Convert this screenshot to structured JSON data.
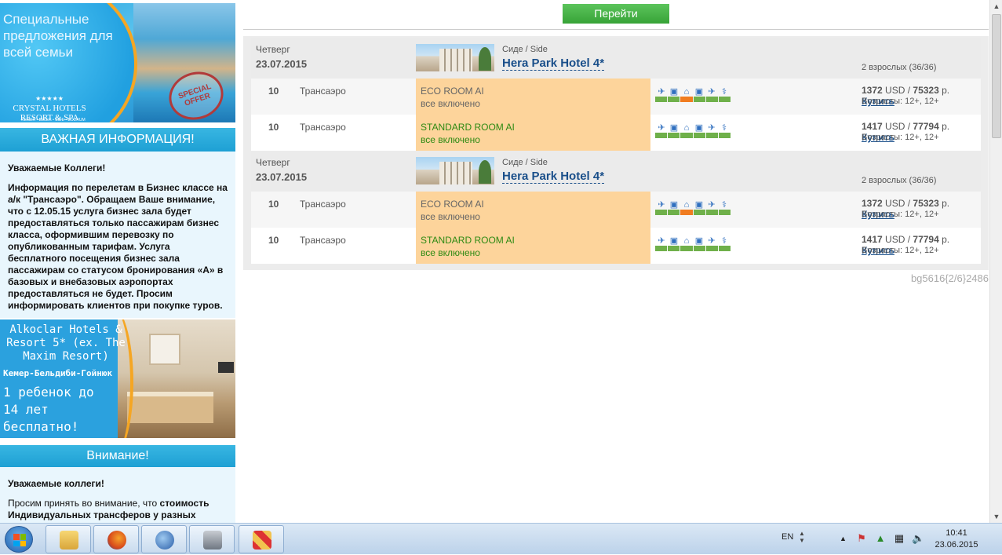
{
  "sidebar": {
    "banner1": {
      "headline": "Специальные предложения для всей семьи",
      "brand": "CRYSTAL HOTELS",
      "brand_sub": "RESORT & SPA",
      "locations": "KEMER • BELEK • SIDE • BODRUM"
    },
    "important": {
      "title": "ВАЖНАЯ ИНФОРМАЦИЯ!",
      "greeting": "Уважаемые Коллеги!",
      "text": "Информация по перелетам в Бизнес классе на а/к \"Трансаэро\". Обращаем Ваше внимание, что с 12.05.15 услуга бизнес зала будет предоставляться только пассажирам бизнес класса, оформившим перевозку по опубликованным тарифам. Услуга бесплатного посещения бизнес зала пассажирам со статусом бронирования «А» в базовых и внебазовых аэропортах предоставляться не будет. Просим информировать клиентов при покупке туров."
    },
    "banner2": {
      "hotel": "Alkoclar Hotels & Resort 5* (ex. The Maxim Resort)",
      "location": "Кемер-Бельдиби-Гойнюк",
      "offer": "1 ребенок до 14 лет бесплатно!"
    },
    "attention": {
      "title": "Внимание!",
      "greeting": "Уважаемые коллеги!",
      "text_plain": "Просим принять во внимание, что",
      "text_bold": "стоимость Индивидуальных трансферов у разных"
    }
  },
  "main": {
    "go_button": "Перейти",
    "hotels": [
      {
        "day": "Четверг",
        "date": "23.07.2015",
        "location": "Сиде / Side",
        "name": "Hera Park Hotel 4*",
        "pax": "2 взрослых (36/36)",
        "rows": [
          {
            "nights": "10",
            "airline": "Трансаэро",
            "room": "ECO ROOM AI",
            "meal": "все включено",
            "room_color": "gray",
            "price_usd": "1372",
            "price_rub": "75323",
            "currency": "USD",
            "rub_suffix": "р.",
            "buy": "Купить",
            "ages": "Возрасты: 12+, 12+",
            "bars": [
              "g",
              "g",
              "o",
              "g",
              "g",
              "g"
            ]
          },
          {
            "nights": "10",
            "airline": "Трансаэро",
            "room": "STANDARD ROOM AI",
            "meal": "все включено",
            "room_color": "green",
            "price_usd": "1417",
            "price_rub": "77794",
            "currency": "USD",
            "rub_suffix": "р.",
            "buy": "Купить",
            "ages": "Возрасты: 12+, 12+",
            "bars": [
              "g",
              "g",
              "g",
              "g",
              "g",
              "g"
            ]
          }
        ]
      },
      {
        "day": "Четверг",
        "date": "23.07.2015",
        "location": "Сиде / Side",
        "name": "Hera Park Hotel 4*",
        "pax": "2 взрослых (36/36)",
        "rows": [
          {
            "nights": "10",
            "airline": "Трансаэро",
            "room": "ECO ROOM AI",
            "meal": "все включено",
            "room_color": "gray",
            "price_usd": "1372",
            "price_rub": "75323",
            "currency": "USD",
            "rub_suffix": "р.",
            "buy": "Купить",
            "ages": "Возрасты: 12+, 12+",
            "bars": [
              "g",
              "g",
              "o",
              "g",
              "g",
              "g"
            ]
          },
          {
            "nights": "10",
            "airline": "Трансаэро",
            "room": "STANDARD ROOM AI",
            "meal": "все включено",
            "room_color": "green",
            "price_usd": "1417",
            "price_rub": "77794",
            "currency": "USD",
            "rub_suffix": "р.",
            "buy": "Купить",
            "ages": "Возрасты: 12+, 12+",
            "bars": [
              "g",
              "g",
              "g",
              "g",
              "g",
              "g"
            ]
          }
        ]
      }
    ],
    "service_icons": [
      "plane-icon",
      "bus-icon",
      "hotel-icon",
      "bus-icon",
      "plane-icon",
      "insurance-icon"
    ],
    "footer_code": "bg5616{2/6}2486"
  },
  "taskbar": {
    "apps": [
      "file-explorer-icon",
      "firefox-icon",
      "thunderbird-icon",
      "archive-icon",
      "app-icon"
    ],
    "lang": "EN",
    "time": "10:41",
    "date": "23.06.2015"
  },
  "colors": {
    "accent_blue": "#1ea0d4",
    "link": "#1a4f8a",
    "room_bg": "#fdd49b",
    "bar_green": "#6fb04a",
    "bar_orange": "#f07c20",
    "go_green": "#37a337"
  }
}
